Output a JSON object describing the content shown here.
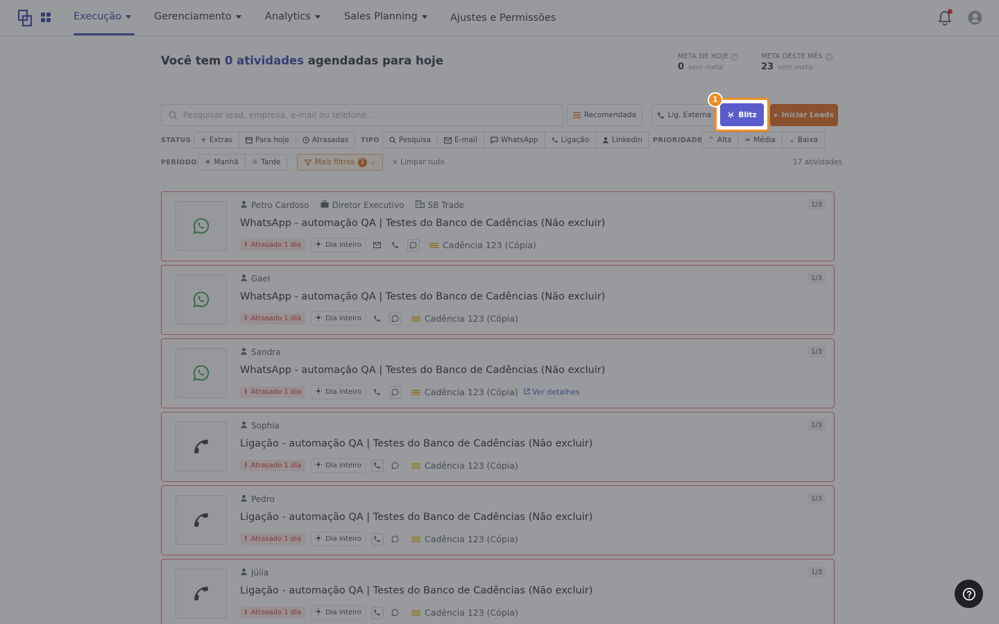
{
  "nav": {
    "items": [
      {
        "label": "Execução",
        "caret": true,
        "active": true
      },
      {
        "label": "Gerenciamento",
        "caret": true
      },
      {
        "label": "Analytics",
        "caret": true
      },
      {
        "label": "Sales Planning",
        "caret": true
      },
      {
        "label": "Ajustes e Permissões",
        "caret": false
      }
    ]
  },
  "header": {
    "prefix": "Você tem ",
    "count": "0",
    "accent": "atividades",
    "suffix": " agendadas para hoje",
    "goal_today": {
      "label": "META DE HOJE",
      "value": "0",
      "sub": "sem meta"
    },
    "goal_month": {
      "label": "META DESTE MÊS",
      "value": "23",
      "sub": "sem meta"
    }
  },
  "search": {
    "placeholder": "Pesquisar lead, empresa, e-mail ou telefone..."
  },
  "actions": {
    "recommended": "Recomendada",
    "external_call": "Lig. Externa",
    "blitz": "Blitz",
    "start_leads": "Iniciar Leads"
  },
  "filters": {
    "status_label": "STATUS",
    "status": [
      "Extras",
      "Para hoje",
      "Atrasadas"
    ],
    "type_label": "TIPO",
    "type": [
      "Pesquisa",
      "E-mail",
      "WhatsApp",
      "Ligação",
      "Linkedin"
    ],
    "priority_label": "PRIORIDADE",
    "priority": [
      "Alta",
      "Média",
      "Baixa"
    ],
    "period_label": "PERÍODO",
    "period": [
      "Manhã",
      "Tarde"
    ],
    "more_filters": "Mais filtros",
    "more_filters_count": "1",
    "clear_all": "Limpar tudo",
    "total": "17 atividades"
  },
  "cards": [
    {
      "channel": "whatsapp",
      "person": "Petro Cardoso",
      "role": "Diretor Executivo",
      "company": "SB Trade",
      "title": "WhatsApp - automação QA | Testes do Banco de Cadências (Não excluir)",
      "late": "Atrasado 1 dia",
      "allday": "Dia inteiro",
      "channels": [
        "mail",
        "phone",
        "whatsapp"
      ],
      "cadence": "Cadência 123 (Cópia)",
      "details": "",
      "step": "1/3"
    },
    {
      "channel": "whatsapp",
      "person": "Gael",
      "role": "",
      "company": "",
      "title": "WhatsApp - automação QA | Testes do Banco de Cadências (Não excluir)",
      "late": "Atrasado 1 dia",
      "allday": "Dia inteiro",
      "channels": [
        "phone",
        "whatsapp"
      ],
      "cadence": "Cadência 123 (Cópia)",
      "details": "",
      "step": "1/3"
    },
    {
      "channel": "whatsapp",
      "person": "Sandra",
      "role": "",
      "company": "",
      "title": "WhatsApp - automação QA | Testes do Banco de Cadências (Não excluir)",
      "late": "Atrasado 1 dia",
      "allday": "Dia inteiro",
      "channels": [
        "phone",
        "whatsapp"
      ],
      "cadence": "Cadência 123 (Cópia)",
      "details": "Ver detalhes",
      "step": "1/3"
    },
    {
      "channel": "phone",
      "person": "Sophia",
      "role": "",
      "company": "",
      "title": "Ligação - automação QA | Testes do Banco de Cadências (Não excluir)",
      "late": "Atrasado 1 dia",
      "allday": "Dia inteiro",
      "channels": [
        "phone",
        "whatsapp"
      ],
      "cadence": "Cadência 123 (Cópia)",
      "details": "",
      "step": "1/3"
    },
    {
      "channel": "phone",
      "person": "Pedro",
      "role": "",
      "company": "",
      "title": "Ligação - automação QA | Testes do Banco de Cadências (Não excluir)",
      "late": "Atrasado 1 dia",
      "allday": "Dia inteiro",
      "channels": [
        "phone",
        "whatsapp"
      ],
      "cadence": "Cadência 123 (Cópia)",
      "details": "",
      "step": "1/3"
    },
    {
      "channel": "phone",
      "person": "Júlia",
      "role": "",
      "company": "",
      "title": "Ligação - automação QA | Testes do Banco de Cadências (Não excluir)",
      "late": "Atrasado 1 dia",
      "allday": "Dia inteiro",
      "channels": [
        "phone",
        "whatsapp"
      ],
      "cadence": "Cadência 123 (Cópia)",
      "details": "",
      "step": "1/3"
    }
  ],
  "tour": {
    "step": "1"
  },
  "colors": {
    "primary": "#2f3fa8",
    "blitz": "#5355c9",
    "leads": "#e0681b",
    "late": "#d42a2a",
    "highlight": "#f08a24"
  }
}
